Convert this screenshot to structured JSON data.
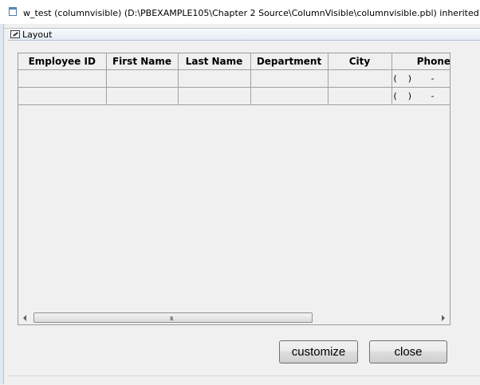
{
  "window": {
    "title": "w_test (columnvisible) (D:\\PBEXAMPLE105\\Chapter 2 Source\\ColumnVisible\\columnvisible.pbl) inherited fro",
    "tab_label": "Layout"
  },
  "datawindow": {
    "columns": [
      "Employee ID",
      "First Name",
      "Last Name",
      "Department",
      "City",
      "Phone"
    ],
    "rows": [
      [
        "",
        "",
        "",
        "",
        "",
        "(    )       -"
      ],
      [
        "",
        "",
        "",
        "",
        "",
        "(    )       -"
      ]
    ]
  },
  "scrollbar": {
    "grip": "III"
  },
  "buttons": {
    "customize": "customize",
    "close": "close"
  }
}
